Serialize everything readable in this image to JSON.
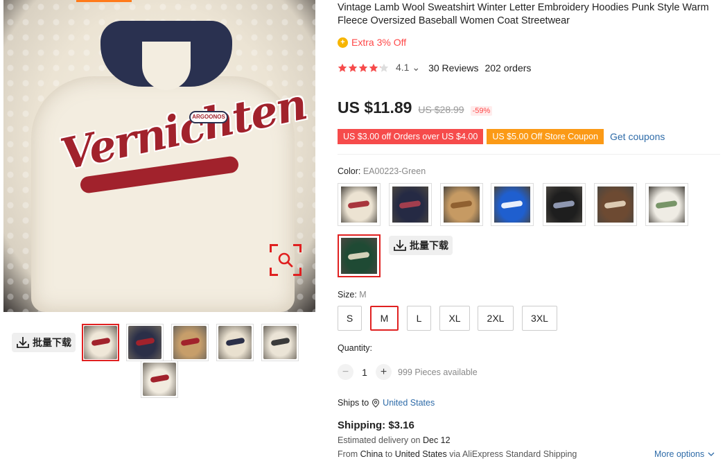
{
  "gallery": {
    "download_label": "批量下载",
    "thumbnails": [
      {
        "name": "cream-sweater-front",
        "colors": [
          "#efe7d8",
          "#a1222c"
        ]
      },
      {
        "name": "navy-sweater",
        "colors": [
          "#2b2f48",
          "#a1222c"
        ]
      },
      {
        "name": "khaki-sweater",
        "colors": [
          "#c79e6a",
          "#a1222c"
        ]
      },
      {
        "name": "cream-navy-pair",
        "colors": [
          "#e9e0cf",
          "#2b2f48"
        ]
      },
      {
        "name": "cream-sweater-side",
        "colors": [
          "#ebe4d6",
          "#3a3a3a"
        ]
      },
      {
        "name": "embroidery-closeup",
        "colors": [
          "#f1ebdf",
          "#a1222c"
        ]
      }
    ]
  },
  "product": {
    "title": "Vintage Lamb Wool Sweatshirt Winter Letter Embroidery Hoodies Punk Style Warm Fleece Oversized Baseball Women Coat Streetwear",
    "extra_off": "Extra 3% Off",
    "rating": {
      "stars": 4.1,
      "score": "4.1",
      "reviews": "30 Reviews",
      "orders": "202 orders"
    },
    "price": {
      "current": "US $11.89",
      "original": "US $28.99",
      "discount": "-59%"
    },
    "coupons": [
      {
        "label": "US $3.00 off Orders over US $4.00",
        "color": "#f64b4b"
      },
      {
        "label": "US $5.00 Off Store Coupon",
        "color": "#fb9a16"
      }
    ],
    "get_coupons": "Get coupons"
  },
  "color": {
    "label": "Color: ",
    "selected": "EA00223-Green",
    "swatches": [
      {
        "name": "cream-red",
        "colors": [
          "#ece3d2",
          "#a1222c"
        ]
      },
      {
        "name": "navy-red",
        "colors": [
          "#252a44",
          "#b04050"
        ]
      },
      {
        "name": "khaki",
        "colors": [
          "#c69a63",
          "#8a5a2a"
        ]
      },
      {
        "name": "blue",
        "colors": [
          "#1f5fcf",
          "#ffffff"
        ]
      },
      {
        "name": "black",
        "colors": [
          "#1e1e1e",
          "#9aa4c0"
        ]
      },
      {
        "name": "brown-stripe",
        "colors": [
          "#6d4a32",
          "#e8d8c0"
        ]
      },
      {
        "name": "white-green",
        "colors": [
          "#efece4",
          "#6a8c5a"
        ]
      },
      {
        "name": "green",
        "colors": [
          "#1f4a34",
          "#e8e0c8"
        ]
      }
    ],
    "download_label": "批量下载"
  },
  "size": {
    "label": "Size: ",
    "selected": "M",
    "options": [
      "S",
      "M",
      "L",
      "XL",
      "2XL",
      "3XL"
    ]
  },
  "quantity": {
    "label": "Quantity:",
    "value": "1",
    "minus": "−",
    "plus": "+",
    "available": "999 Pieces available"
  },
  "shipping": {
    "ships_to_label": "Ships to",
    "country": "United States",
    "cost": "Shipping: $3.16",
    "delivery_prefix": "Estimated delivery on ",
    "delivery_date": "Dec 12",
    "from_prefix": "From ",
    "from_country": "China",
    "to_word": " to ",
    "to_country": "United States",
    "via": " via AliExpress Standard Shipping",
    "more_options": "More options"
  }
}
